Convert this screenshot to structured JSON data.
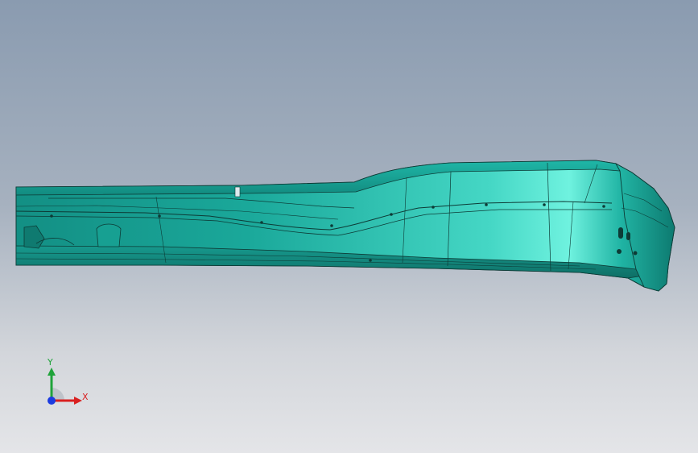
{
  "viewport": {
    "background_top": "#8a9bb0",
    "background_bottom": "#e4e5e8"
  },
  "model": {
    "face_color": "#1aa89a",
    "highlight_color": "#6ff2df",
    "edge_color": "#0d3b36"
  },
  "triad": {
    "x_label": "X",
    "y_label": "Y",
    "x_color": "#d92020",
    "y_color": "#1fa33a",
    "z_color": "#1b3be0"
  }
}
